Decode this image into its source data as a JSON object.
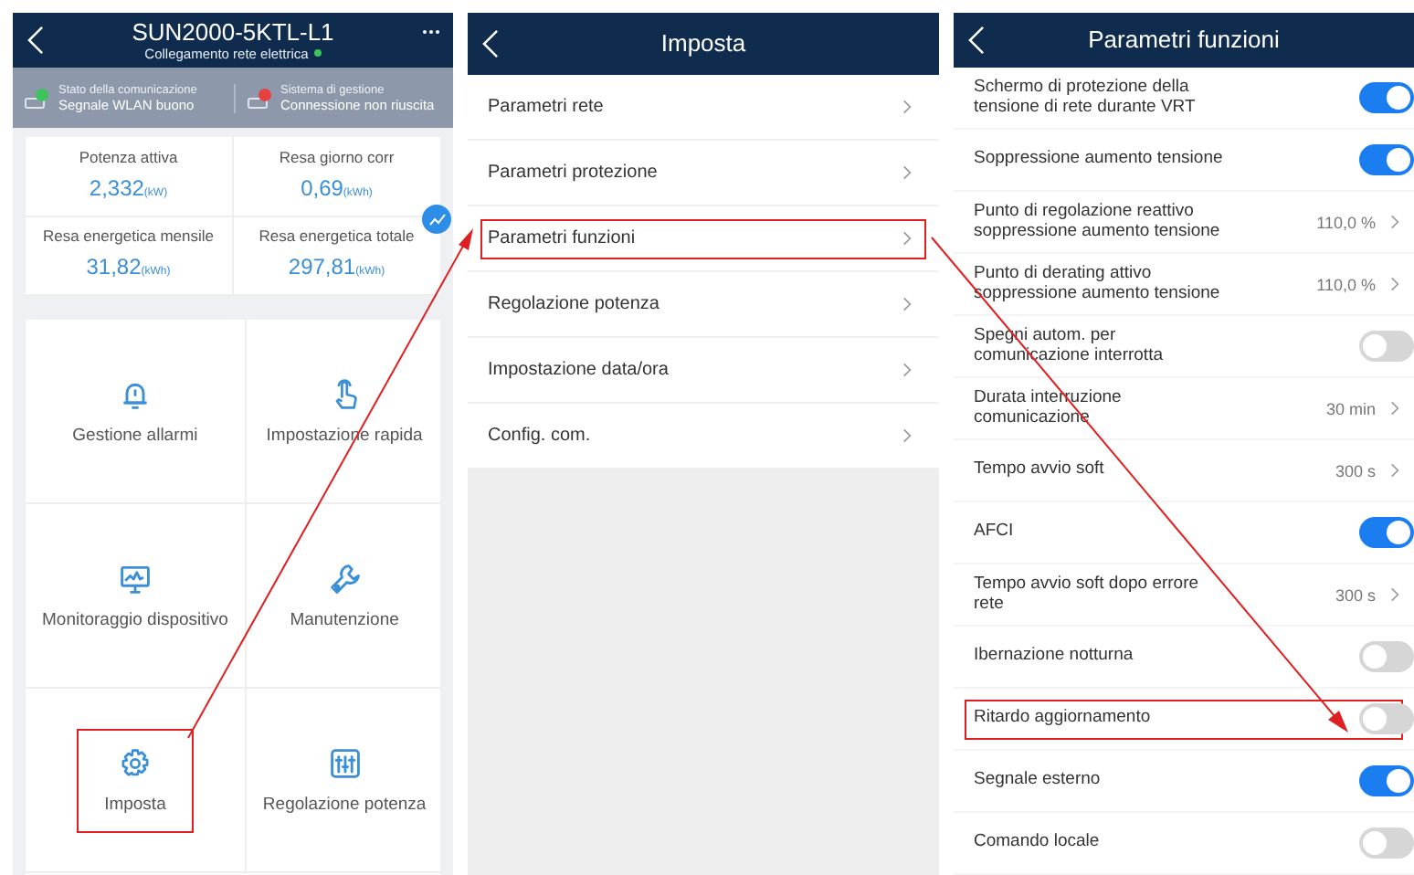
{
  "device_screen": {
    "title": "SUN2000-5KTL-L1",
    "subtitle": "Collegamento rete elettrica",
    "status": [
      {
        "label": "Stato della comunicazione",
        "value": "Segnale WLAN buono",
        "color": "#3cc35b"
      },
      {
        "label": "Sistema di gestione",
        "value": "Connessione non riuscita",
        "color": "#e84040"
      }
    ],
    "stats": [
      {
        "label": "Potenza attiva",
        "value": "2,332",
        "unit": "(kW)"
      },
      {
        "label": "Resa giorno corr",
        "value": "0,69",
        "unit": "(kWh)"
      },
      {
        "label": "Resa energetica mensile",
        "value": "31,82",
        "unit": "(kWh)"
      },
      {
        "label": "Resa energetica totale",
        "value": "297,81",
        "unit": "(kWh)"
      }
    ],
    "tiles": [
      {
        "kind": "bell",
        "label": "Gestione allarmi",
        "highlighted": false
      },
      {
        "kind": "hand",
        "label": "Impostazione rapida",
        "highlighted": false
      },
      {
        "kind": "monitor",
        "label": "Monitoraggio dispositivo",
        "highlighted": false
      },
      {
        "kind": "wrench",
        "label": "Manutenzione",
        "highlighted": false
      },
      {
        "kind": "gear",
        "label": "Imposta",
        "highlighted": true
      },
      {
        "kind": "sliders",
        "label": "Regolazione potenza",
        "highlighted": false
      }
    ]
  },
  "settings_screen": {
    "title": "Imposta",
    "items": [
      {
        "label": "Parametri rete",
        "highlighted": false
      },
      {
        "label": "Parametri protezione",
        "highlighted": false
      },
      {
        "label": "Parametri funzioni",
        "highlighted": true
      },
      {
        "label": "Regolazione potenza",
        "highlighted": false
      },
      {
        "label": "Impostazione data/ora",
        "highlighted": false
      },
      {
        "label": "Config. com.",
        "highlighted": false
      }
    ]
  },
  "functions_screen": {
    "title": "Parametri funzioni",
    "items": [
      {
        "kind": "toggle",
        "label": "Schermo di protezione della tensione di rete durante VRT",
        "on": true,
        "highlighted": false
      },
      {
        "kind": "toggle",
        "label": "Soppressione aumento tensione",
        "on": true,
        "highlighted": false
      },
      {
        "kind": "value",
        "label": "Punto di regolazione reattivo soppressione aumento tensione",
        "value": "110,0 %",
        "highlighted": false
      },
      {
        "kind": "value",
        "label": "Punto di derating attivo soppressione aumento tensione",
        "value": "110,0 %",
        "highlighted": false
      },
      {
        "kind": "toggle",
        "label": "Spegni autom. per comunicazione interrotta",
        "on": false,
        "highlighted": false
      },
      {
        "kind": "value",
        "label": "Durata interruzione comunicazione",
        "value": "30 min",
        "highlighted": false
      },
      {
        "kind": "value",
        "label": "Tempo avvio soft",
        "value": "300 s",
        "highlighted": false
      },
      {
        "kind": "toggle",
        "label": "AFCI",
        "on": true,
        "highlighted": false
      },
      {
        "kind": "value",
        "label": "Tempo avvio soft dopo errore rete",
        "value": "300 s",
        "highlighted": false
      },
      {
        "kind": "toggle",
        "label": "Ibernazione notturna",
        "on": false,
        "highlighted": false
      },
      {
        "kind": "toggle",
        "label": "Ritardo aggiornamento",
        "on": false,
        "highlighted": true
      },
      {
        "kind": "toggle",
        "label": "Segnale esterno",
        "on": true,
        "highlighted": false
      },
      {
        "kind": "toggle",
        "label": "Comando locale",
        "on": false,
        "highlighted": false
      }
    ]
  }
}
